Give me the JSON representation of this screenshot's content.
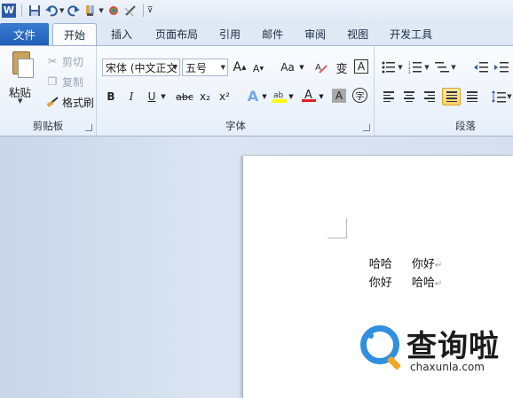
{
  "quick_access": {
    "icons": [
      "word-logo-icon",
      "save-icon",
      "undo-icon",
      "redo-icon",
      "format-painter-icon",
      "color-icon",
      "pen-icon",
      "customize-icon"
    ]
  },
  "tabs": {
    "file": "文件",
    "items": [
      "开始",
      "插入",
      "页面布局",
      "引用",
      "邮件",
      "审阅",
      "视图",
      "开发工具"
    ],
    "active": "开始"
  },
  "clipboard": {
    "paste": "粘贴",
    "cut": "剪切",
    "copy": "复制",
    "format_painter": "格式刷",
    "label": "剪贴板"
  },
  "font": {
    "font_name": "宋体 (中文正文",
    "font_size": "五号",
    "bold": "B",
    "italic": "I",
    "underline": "U",
    "strike": "abc",
    "subscript": "x₂",
    "superscript": "x²",
    "grow": "A",
    "shrink": "A",
    "case": "Aa",
    "phonetic": "变",
    "border_char": "A",
    "shade_char": "A",
    "enclose": "字",
    "label": "字体"
  },
  "paragraph": {
    "label": "段落"
  },
  "document": {
    "lines": [
      {
        "a": "哈哈",
        "b": "你好"
      },
      {
        "a": "你好",
        "b": "哈哈"
      }
    ],
    "return_mark": "↵"
  },
  "watermark": {
    "title": "查询啦",
    "url": "chaxunla.com"
  },
  "colors": {
    "file_tab": "#2a69c4",
    "highlight": "#ffff00",
    "font_color": "#e02020",
    "active_align": "#ffd264"
  }
}
